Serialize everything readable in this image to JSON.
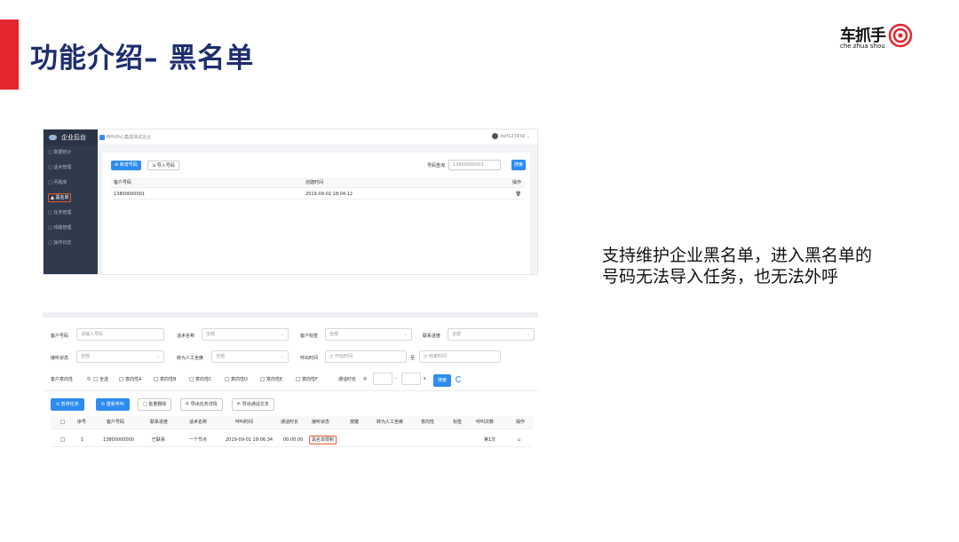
{
  "slide": {
    "title": "功能介绍– 黑名单",
    "description_lines": [
      "支持维护企业黑名单，进入黑名单的",
      "号码无法导入任务，也无法外呼"
    ]
  },
  "logo": {
    "text": "车抓手",
    "subtext": "che zhua shou"
  },
  "shot1": {
    "brand": "企业后台",
    "breadcrumb": "呼叫中心集成测试企业",
    "user": "dwf123456",
    "nav": [
      "数据统计",
      "话术管理",
      "问题库",
      "黑名单",
      "任务管理",
      "线路管理",
      "操作日志"
    ],
    "add_btn": "新增号码",
    "import_btn": "导入号码",
    "query_label": "号码查询",
    "query_value": "13800000001",
    "search_btn": "搜索",
    "columns": [
      "客户号码",
      "创建时间",
      "操作"
    ],
    "rows": [
      {
        "phone": "13800000001",
        "created": "2019-09-01 18:04:12",
        "action_icon": "trash-icon"
      }
    ]
  },
  "shot2": {
    "filters": {
      "customer_phone_label": "客户号码",
      "customer_phone_placeholder": "请输入号码",
      "script_label": "话术名称",
      "script_value": "全部",
      "tag_label": "客户标签",
      "tag_value": "全部",
      "progress_label": "联系进度",
      "progress_value": "全部",
      "answer_label": "接听状态",
      "answer_value": "全部",
      "transfer_label": "转为人工坐席",
      "transfer_value": "全部",
      "call_time_label": "呼出时间",
      "start_placeholder": "开始时间",
      "to": "至",
      "end_placeholder": "结束时间",
      "intent_label": "客户意向性",
      "intents": [
        "全选",
        "意向性A",
        "意向性B",
        "意向性C",
        "意向性D",
        "意向性E",
        "意向性F"
      ],
      "duration_label": "通话时长",
      "duration_unit": "s",
      "search_btn": "搜索"
    },
    "actions": [
      "暂停任务",
      "重新呼叫",
      "批量删除",
      "导出任务详情",
      "导出通话文本"
    ],
    "columns": [
      "序号",
      "客户号码",
      "联系进度",
      "话术名称",
      "呼叫时间",
      "通话时长",
      "接听状态",
      "按键",
      "转为人工坐席",
      "意向性",
      "标签",
      "呼叫次数",
      "操作"
    ],
    "rows": [
      {
        "index": "1",
        "phone": "13800000000",
        "progress": "已联系",
        "script": "一个节点",
        "time": "2019-09-01 18:06:34",
        "duration": "00:00:00",
        "status": "黑名单限制",
        "count": "第1次"
      }
    ]
  }
}
